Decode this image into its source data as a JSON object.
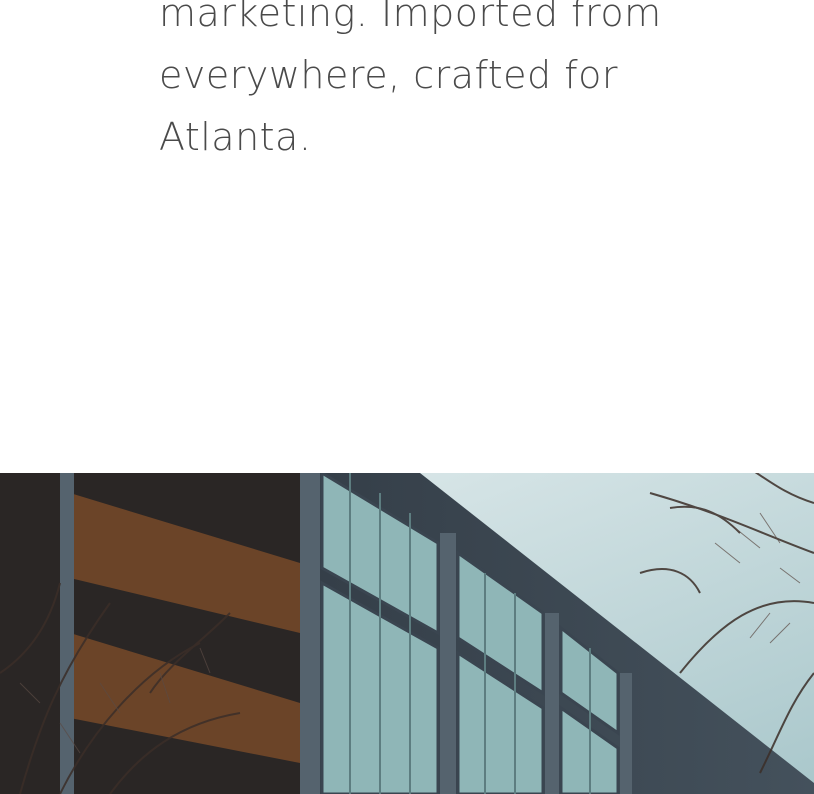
{
  "intro": {
    "lines": [
      "marketing. Imported from",
      "everywhere, crafted for",
      "Atlanta."
    ]
  },
  "hero_image": {
    "subject": "modern-office-building-with-bare-trees",
    "colors": {
      "sky": "#cfe1e3",
      "building": "#3a4550",
      "glass": "#8fb6b7",
      "branches": "#3b2e28",
      "garage": "#5a3b25"
    }
  }
}
